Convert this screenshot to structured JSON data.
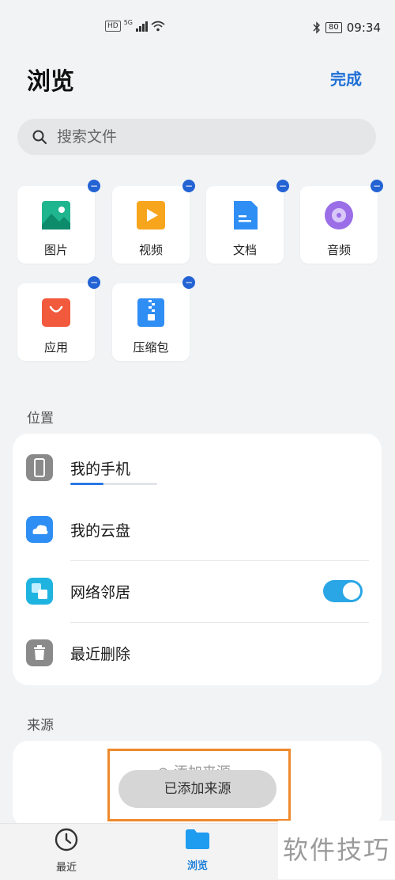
{
  "status_bar": {
    "network_type": "5G",
    "hd_label": "HD",
    "battery": "80",
    "time": "09:34"
  },
  "header": {
    "title": "浏览",
    "done_label": "完成"
  },
  "search": {
    "placeholder": "搜索文件"
  },
  "categories": [
    {
      "label": "图片",
      "icon": "image-icon"
    },
    {
      "label": "视频",
      "icon": "video-icon"
    },
    {
      "label": "文档",
      "icon": "document-icon"
    },
    {
      "label": "音频",
      "icon": "audio-icon"
    },
    {
      "label": "应用",
      "icon": "app-bag-icon"
    },
    {
      "label": "压缩包",
      "icon": "archive-icon"
    }
  ],
  "locations": {
    "section_title": "位置",
    "items": [
      {
        "label": "我的手机",
        "icon": "phone-icon",
        "storage_used_fraction": 0.38
      },
      {
        "label": "我的云盘",
        "icon": "cloud-icon"
      },
      {
        "label": "网络邻居",
        "icon": "network-neighbor-icon",
        "toggle_on": true
      },
      {
        "label": "最近删除",
        "icon": "trash-icon"
      }
    ]
  },
  "sources": {
    "section_title": "来源",
    "add_label": "添加来源"
  },
  "toast": {
    "message": "已添加来源"
  },
  "bottom_nav": {
    "items": [
      {
        "label": "最近",
        "icon": "clock-icon",
        "active": false
      },
      {
        "label": "浏览",
        "icon": "folder-icon",
        "active": true
      }
    ]
  },
  "watermark": {
    "text": "软件技巧"
  },
  "colors": {
    "accent": "#1f6fd6",
    "toggle": "#2aa6e6",
    "highlight": "#ee8a2c",
    "background": "#f1f3f5"
  }
}
